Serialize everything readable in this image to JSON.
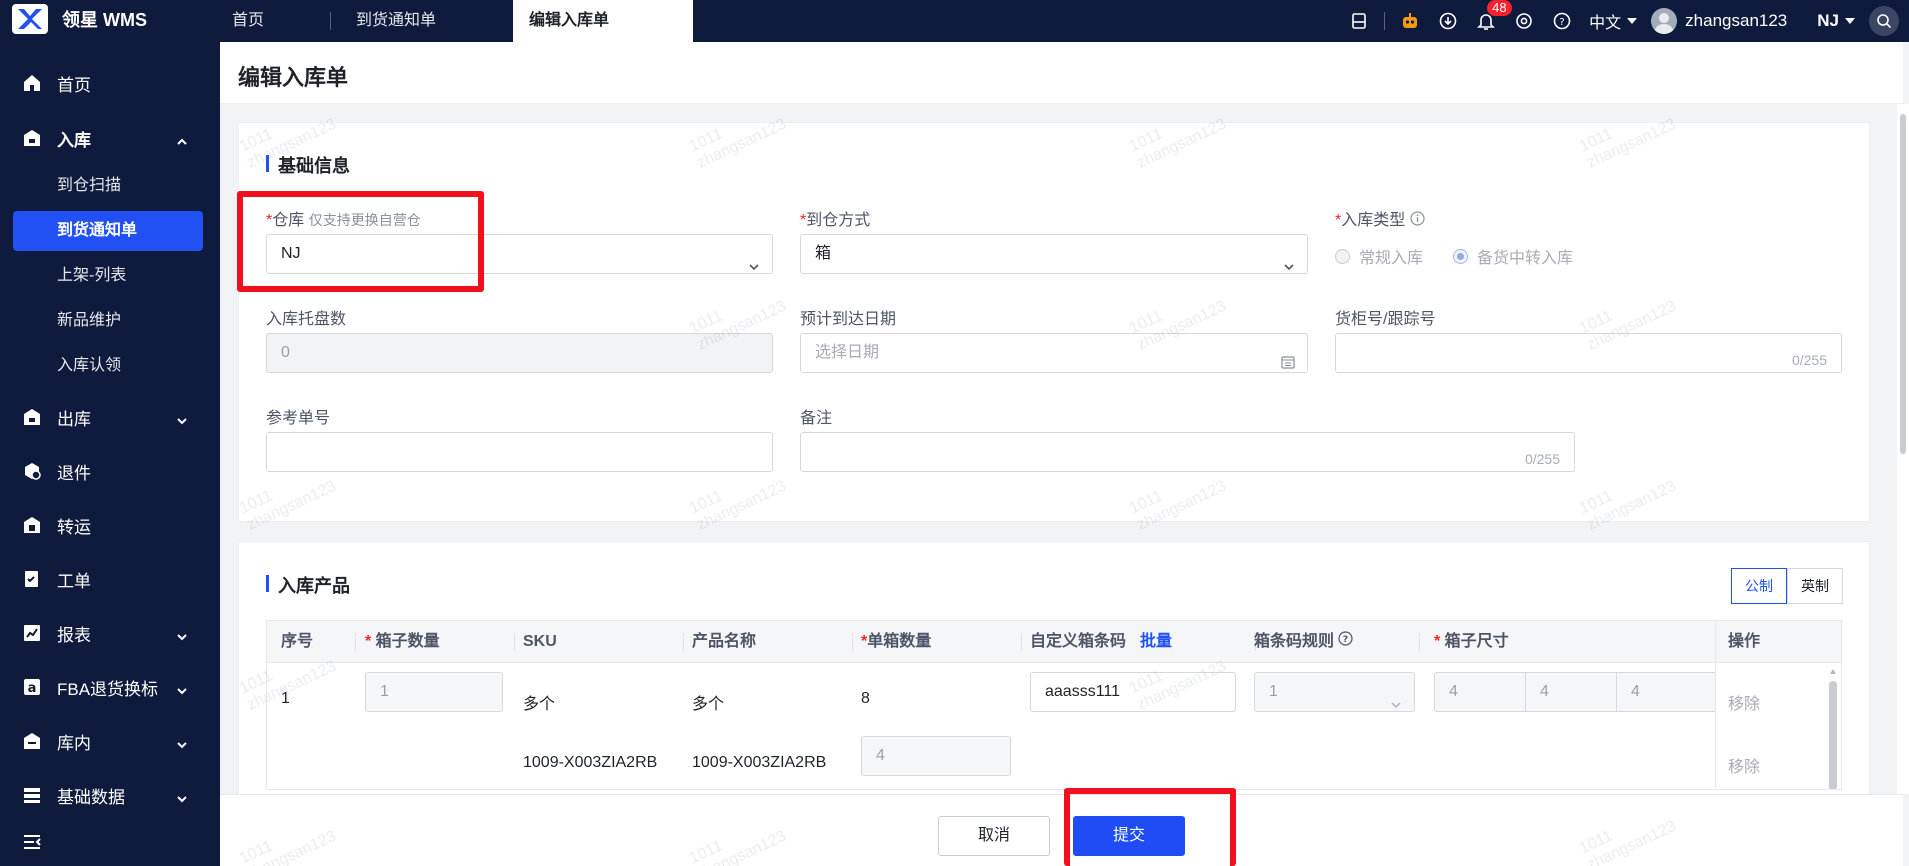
{
  "app": {
    "name": "领星 WMS"
  },
  "tabs": [
    {
      "label": "首页"
    },
    {
      "label": "到货通知单"
    },
    {
      "label": "编辑入库单",
      "active": true
    }
  ],
  "topbar": {
    "notification_count": "48",
    "language": "中文",
    "username": "zhangsan123",
    "warehouse": "NJ"
  },
  "sidebar": {
    "items": [
      {
        "label": "首页",
        "icon": "home-icon"
      },
      {
        "label": "入库",
        "icon": "inbound-icon",
        "expanded": true
      },
      {
        "label": "出库",
        "icon": "outbound-icon"
      },
      {
        "label": "退件",
        "icon": "return-icon"
      },
      {
        "label": "转运",
        "icon": "transfer-icon"
      },
      {
        "label": "工单",
        "icon": "workorder-icon"
      },
      {
        "label": "报表",
        "icon": "report-icon"
      },
      {
        "label": "FBA退货换标",
        "icon": "amazon-icon"
      },
      {
        "label": "库内",
        "icon": "warehouse-icon"
      },
      {
        "label": "基础数据",
        "icon": "data-icon"
      }
    ],
    "sub_items": [
      {
        "label": "到仓扫描"
      },
      {
        "label": "到货通知单",
        "active": true
      },
      {
        "label": "上架-列表"
      },
      {
        "label": "新品维护"
      },
      {
        "label": "入库认领"
      }
    ]
  },
  "page": {
    "title": "编辑入库单"
  },
  "basic_info": {
    "title": "基础信息",
    "warehouse": {
      "label": "仓库",
      "hint": "仅支持更换自营仓",
      "value": "NJ"
    },
    "arrival_method": {
      "label": "到仓方式",
      "value": "箱"
    },
    "inbound_type": {
      "label": "入库类型",
      "options": [
        "常规入库",
        "备货中转入库"
      ],
      "selected": "备货中转入库"
    },
    "pallet_count": {
      "label": "入库托盘数",
      "value": "0"
    },
    "eta": {
      "label": "预计到达日期",
      "placeholder": "选择日期"
    },
    "container_no": {
      "label": "货柜号/跟踪号",
      "counter": "0/255"
    },
    "reference_no": {
      "label": "参考单号"
    },
    "remark": {
      "label": "备注",
      "counter": "0/255"
    }
  },
  "products": {
    "title": "入库产品",
    "unit_options": [
      "公制",
      "英制"
    ],
    "unit_selected": "公制",
    "columns": {
      "index": "序号",
      "box_qty": "箱子数量",
      "sku": "SKU",
      "name": "产品名称",
      "per_box_qty": "单箱数量",
      "custom_barcode": "自定义箱条码",
      "batch_link": "批量",
      "barcode_rule": "箱条码规则",
      "box_size": "箱子尺寸",
      "action": "操作"
    },
    "rows": [
      {
        "index": "1",
        "box_qty": "1",
        "sku": "多个",
        "name": "多个",
        "per_box_qty": "8",
        "custom_barcode": "aaasss111",
        "barcode_rule": "1",
        "dims": [
          "4",
          "4",
          "4"
        ],
        "action": "移除"
      },
      {
        "index": "",
        "box_qty": "",
        "sku": "1009-X003ZIA2RB",
        "name": "1009-X003ZIA2RB",
        "per_box_qty": "4",
        "action": "移除"
      }
    ]
  },
  "footer": {
    "cancel": "取消",
    "submit": "提交"
  },
  "watermark": {
    "line1": "1011",
    "line2": "zhangsan123"
  },
  "colors": {
    "nav_bg": "#0e1b3d",
    "primary": "#2150f5",
    "highlight": "#f2101e"
  }
}
